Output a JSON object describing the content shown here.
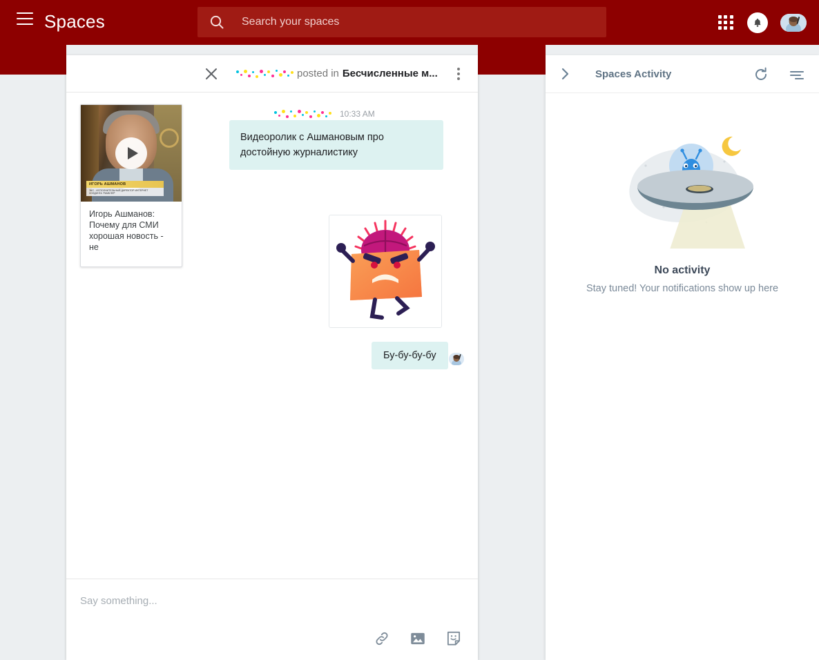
{
  "appbar": {
    "brand": "Spaces",
    "menu_icon": "hamburger-menu-icon",
    "search_icon": "search-icon",
    "search_placeholder": "Search your spaces",
    "search_value": "",
    "apps_icon": "apps-grid-icon",
    "bell_icon": "notifications-bell-icon",
    "avatar_icon": "user-avatar",
    "background_color": "#8d0000",
    "search_background_color": "#a01b14"
  },
  "chat": {
    "header": {
      "close_icon": "close-icon",
      "author_redacted": "",
      "posted_in": "posted in",
      "space_name": "Бесчисленные м...",
      "more_icon": "more-vertical-icon"
    },
    "video_card": {
      "play_icon": "play-button-icon",
      "overlay_name": "ИГОРЬ АШМАНОВ",
      "overlay_role": "ЭКС - ИСПОЛНИТЕЛЬНЫЙ ДИРЕКТОР ИНТЕРНЕТ ХОЛДИНГА 'РАМБЛЕР'",
      "title": "Игорь Ашманов: Почему для СМИ хорошая новость - не"
    },
    "messages": [
      {
        "author_redacted": "",
        "time": "10:33 AM",
        "text": "Видеоролик с Ашмановым про достойную журналистику"
      },
      {
        "type": "sticker",
        "name": "angry-character-sticker"
      },
      {
        "text": "Бу-бу-бу-бу",
        "avatar": "user-avatar"
      }
    ],
    "bubble_color": "#ddf2f1",
    "compose": {
      "placeholder": "Say something...",
      "value": "",
      "link_icon": "link-icon",
      "image_icon": "image-icon",
      "sticker_icon": "sticker-icon"
    }
  },
  "activity": {
    "expand_icon": "chevron-right-icon",
    "title": "Spaces Activity",
    "refresh_icon": "refresh-icon",
    "filter_icon": "filter-list-icon",
    "illustration": "ufo-alien-illustration",
    "empty_title": "No activity",
    "empty_subtitle": "Stay tuned! Your notifications show up here"
  }
}
